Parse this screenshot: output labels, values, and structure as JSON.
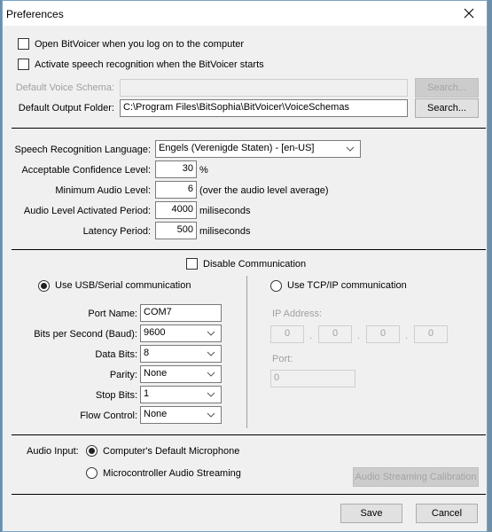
{
  "window": {
    "title": "Preferences",
    "close_icon": "close-icon"
  },
  "startup": {
    "open_on_logon": {
      "label": "Open BitVoicer when you log on to the computer",
      "checked": false
    },
    "activate_recognition": {
      "label": "Activate speech recognition when the BitVoicer starts",
      "checked": false
    }
  },
  "folders": {
    "default_voice_schema": {
      "label": "Default Voice Schema:",
      "value": "",
      "enabled": false,
      "search_label": "Search..."
    },
    "default_output_folder": {
      "label": "Default Output Folder:",
      "value": "C:\\Program Files\\BitSophia\\BitVoicer\\VoiceSchemas",
      "enabled": true,
      "search_label": "Search..."
    }
  },
  "recognition": {
    "language": {
      "label": "Speech Recognition Language:",
      "value": "Engels (Verenigde Staten) - [en-US]"
    },
    "confidence": {
      "label": "Acceptable Confidence Level:",
      "value": "30",
      "unit": "%"
    },
    "min_audio": {
      "label": "Minimum Audio Level:",
      "value": "6",
      "unit": "(over the audio level average)"
    },
    "activated_period": {
      "label": "Audio Level Activated Period:",
      "value": "4000",
      "unit": "miliseconds"
    },
    "latency": {
      "label": "Latency Period:",
      "value": "500",
      "unit": "miliseconds"
    }
  },
  "communication": {
    "disable": {
      "label": "Disable Communication",
      "checked": false
    },
    "usb": {
      "label": "Use USB/Serial communication",
      "selected": true,
      "port_name": {
        "label": "Port Name:",
        "value": "COM7"
      },
      "baud": {
        "label": "Bits per Second (Baud):",
        "value": "9600"
      },
      "data_bits": {
        "label": "Data Bits:",
        "value": "8"
      },
      "parity": {
        "label": "Parity:",
        "value": "None"
      },
      "stop_bits": {
        "label": "Stop Bits:",
        "value": "1"
      },
      "flow_control": {
        "label": "Flow Control:",
        "value": "None"
      }
    },
    "tcp": {
      "label": "Use TCP/IP communication",
      "selected": false,
      "ip_label": "IP Address:",
      "ip": [
        "0",
        "0",
        "0",
        "0"
      ],
      "ip_dot": ".",
      "port_label": "Port:",
      "port": "0"
    }
  },
  "audio_input": {
    "label": "Audio Input:",
    "options": [
      {
        "label": "Computer's Default Microphone",
        "selected": true
      },
      {
        "label": "Microcontroller Audio Streaming",
        "selected": false
      }
    ],
    "calibration_label": "Audio Streaming Calibration"
  },
  "footer": {
    "save_label": "Save",
    "cancel_label": "Cancel"
  }
}
